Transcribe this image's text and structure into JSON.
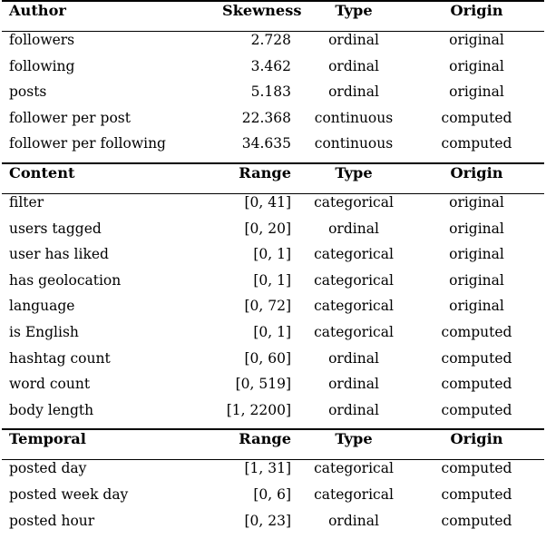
{
  "table": {
    "sections": [
      {
        "id": "author",
        "headers": [
          "Author",
          "Skewness",
          "Type",
          "Origin"
        ],
        "rows": [
          [
            "followers",
            "2.728",
            "ordinal",
            "original"
          ],
          [
            "following",
            "3.462",
            "ordinal",
            "original"
          ],
          [
            "posts",
            "5.183",
            "ordinal",
            "original"
          ],
          [
            "follower per post",
            "22.368",
            "continuous",
            "computed"
          ],
          [
            "follower per following",
            "34.635",
            "continuous",
            "computed"
          ]
        ]
      },
      {
        "id": "content",
        "headers": [
          "Content",
          "Range",
          "Type",
          "Origin"
        ],
        "rows": [
          [
            "filter",
            "[0, 41]",
            "categorical",
            "original"
          ],
          [
            "users tagged",
            "[0, 20]",
            "ordinal",
            "original"
          ],
          [
            "user has liked",
            "[0, 1]",
            "categorical",
            "original"
          ],
          [
            "has geolocation",
            "[0, 1]",
            "categorical",
            "original"
          ],
          [
            "language",
            "[0, 72]",
            "categorical",
            "original"
          ],
          [
            "is English",
            "[0, 1]",
            "categorical",
            "computed"
          ],
          [
            "hashtag count",
            "[0, 60]",
            "ordinal",
            "computed"
          ],
          [
            "word count",
            "[0, 519]",
            "ordinal",
            "computed"
          ],
          [
            "body length",
            "[1, 2200]",
            "ordinal",
            "computed"
          ]
        ]
      },
      {
        "id": "temporal",
        "headers": [
          "Temporal",
          "Range",
          "Type",
          "Origin"
        ],
        "rows": [
          [
            "posted day",
            "[1, 31]",
            "categorical",
            "computed"
          ],
          [
            "posted week day",
            "[0, 6]",
            "categorical",
            "computed"
          ],
          [
            "posted hour",
            "[0, 23]",
            "ordinal",
            "computed"
          ]
        ]
      }
    ]
  },
  "style": {
    "text_color": "#000000",
    "background_color": "#ffffff",
    "rule_color": "#000000"
  }
}
